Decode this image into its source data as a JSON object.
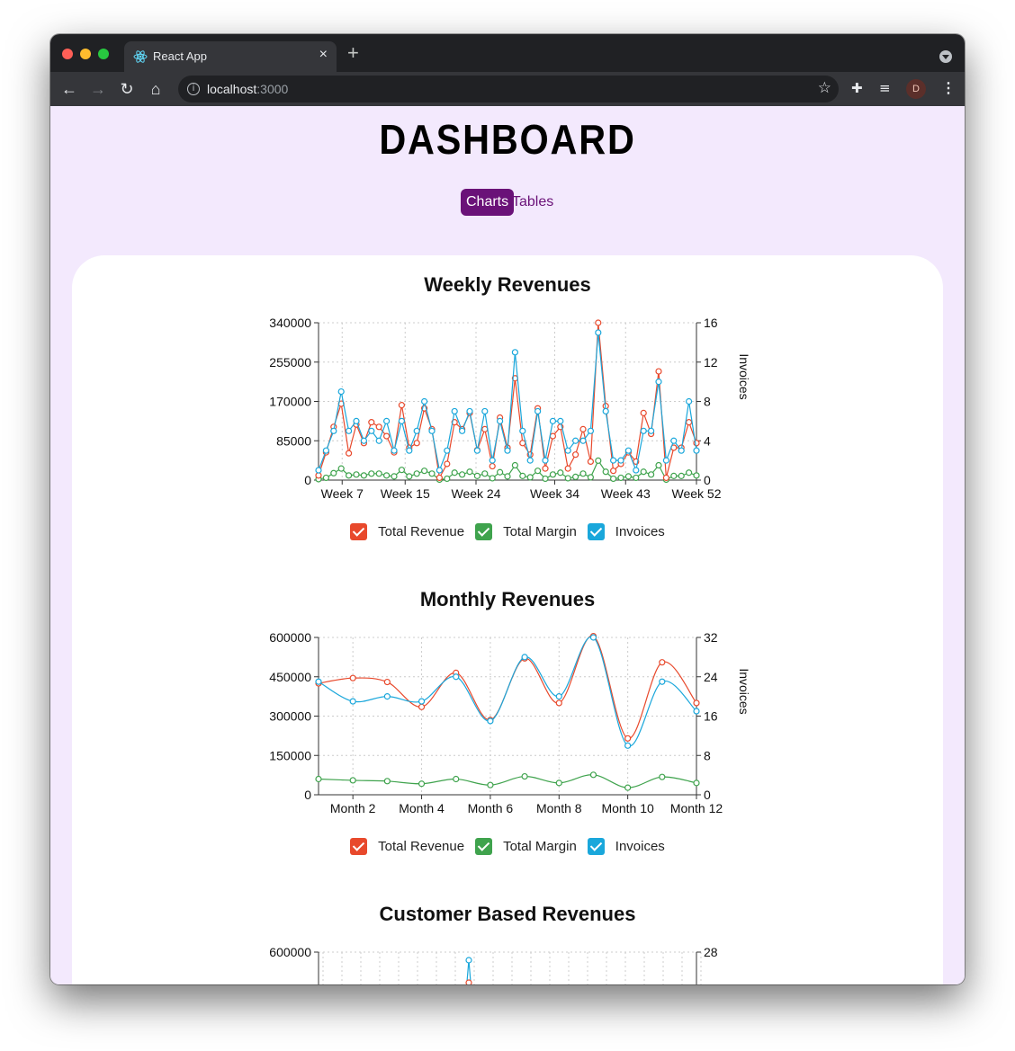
{
  "browser": {
    "tab_title": "React App",
    "url_host": "localhost",
    "url_port": ":3000",
    "avatar_letter": "D"
  },
  "page": {
    "title": "DASHBOARD",
    "nav": [
      {
        "label": "Charts",
        "active": true
      },
      {
        "label": "Tables",
        "active": false
      }
    ]
  },
  "colors": {
    "revenue": "#e8492c",
    "margin": "#3fa34d",
    "invoices": "#1aa7db",
    "accent": "#6a1278"
  },
  "chart_data": [
    {
      "type": "line",
      "title": "Weekly Revenues",
      "y2label": "Invoices",
      "ylim": [
        0,
        340000
      ],
      "y2lim": [
        0,
        16
      ],
      "yticks": [
        "340000",
        "255000",
        "170000",
        "85000",
        "0"
      ],
      "y2ticks": [
        "16",
        "12",
        "8",
        "4",
        "0"
      ],
      "xtick_labels": [
        "Week 7",
        "Week 15",
        "Week 24",
        "Week 34",
        "Week 43",
        "Week 52"
      ],
      "xtick_positions": [
        7,
        15,
        24,
        34,
        43,
        52
      ],
      "x_range": [
        4,
        52
      ],
      "legend": [
        "Total Revenue",
        "Total Margin",
        "Invoices"
      ],
      "series": [
        {
          "name": "Total Revenue",
          "axis": "left",
          "values": [
            10000,
            60000,
            115000,
            165000,
            58000,
            120000,
            80000,
            125000,
            115000,
            95000,
            60000,
            162000,
            70000,
            80000,
            155000,
            110000,
            5000,
            35000,
            125000,
            110000,
            145000,
            65000,
            110000,
            30000,
            135000,
            70000,
            220000,
            80000,
            55000,
            155000,
            25000,
            95000,
            115000,
            25000,
            55000,
            110000,
            40000,
            340000,
            160000,
            20000,
            35000,
            60000,
            40000,
            145000,
            100000,
            235000,
            5000,
            70000,
            70000,
            125000,
            80000
          ]
        },
        {
          "name": "Total Margin",
          "axis": "left",
          "values": [
            2000,
            5000,
            15000,
            25000,
            10000,
            12000,
            10000,
            14000,
            14000,
            10000,
            8000,
            22000,
            8000,
            14000,
            20000,
            14000,
            1000,
            3000,
            16000,
            12000,
            18000,
            9000,
            14000,
            4000,
            17000,
            8000,
            32000,
            9000,
            6000,
            20000,
            3000,
            12000,
            16000,
            4000,
            7000,
            14000,
            6000,
            42000,
            18000,
            3000,
            5000,
            8000,
            5000,
            18000,
            12000,
            32000,
            1000,
            9000,
            9000,
            16000,
            10000
          ]
        },
        {
          "name": "Invoices",
          "axis": "right",
          "values": [
            1,
            3,
            5,
            9,
            5,
            6,
            4,
            5,
            4,
            6,
            3,
            6,
            3,
            5,
            8,
            5,
            1,
            3,
            7,
            5,
            7,
            3,
            7,
            2,
            6,
            3,
            13,
            5,
            2,
            7,
            2,
            6,
            6,
            3,
            4,
            4,
            5,
            15,
            7,
            2,
            2,
            3,
            1,
            5,
            5,
            10,
            2,
            4,
            3,
            8,
            3
          ]
        }
      ]
    },
    {
      "type": "line",
      "title": "Monthly Revenues",
      "y2label": "Invoices",
      "ylim": [
        0,
        600000
      ],
      "y2lim": [
        0,
        32
      ],
      "yticks": [
        "600000",
        "450000",
        "300000",
        "150000",
        "0"
      ],
      "y2ticks": [
        "32",
        "24",
        "16",
        "8",
        "0"
      ],
      "xtick_labels": [
        "Month 2",
        "Month 4",
        "Month 6",
        "Month 8",
        "Month 10",
        "Month 12"
      ],
      "xtick_positions": [
        2,
        4,
        6,
        8,
        10,
        12
      ],
      "x_range": [
        1,
        12
      ],
      "legend": [
        "Total Revenue",
        "Total Margin",
        "Invoices"
      ],
      "series": [
        {
          "name": "Total Revenue",
          "axis": "left",
          "x": [
            1,
            2,
            3,
            4,
            5,
            6,
            7,
            8,
            9,
            10,
            11,
            12
          ],
          "values": [
            425000,
            445000,
            430000,
            335000,
            465000,
            285000,
            520000,
            350000,
            605000,
            215000,
            505000,
            350000
          ]
        },
        {
          "name": "Total Margin",
          "axis": "left",
          "x": [
            1,
            2,
            3,
            4,
            5,
            6,
            7,
            8,
            9,
            10,
            11,
            12
          ],
          "values": [
            60000,
            55000,
            52000,
            42000,
            60000,
            37000,
            70000,
            45000,
            76000,
            27000,
            68000,
            45000
          ]
        },
        {
          "name": "Invoices",
          "axis": "right",
          "x": [
            1,
            2,
            3,
            4,
            5,
            6,
            7,
            8,
            9,
            10,
            11,
            12
          ],
          "values": [
            23,
            19,
            20,
            19,
            24,
            15,
            28,
            20,
            32,
            10,
            23,
            17
          ]
        }
      ]
    },
    {
      "type": "line",
      "title": "Customer Based Revenues",
      "ylim": [
        0,
        600000
      ],
      "y2lim": [
        0,
        28
      ],
      "yticks": [
        "600000"
      ],
      "y2ticks": [
        "28"
      ],
      "xtick_labels": [],
      "legend": []
    }
  ]
}
